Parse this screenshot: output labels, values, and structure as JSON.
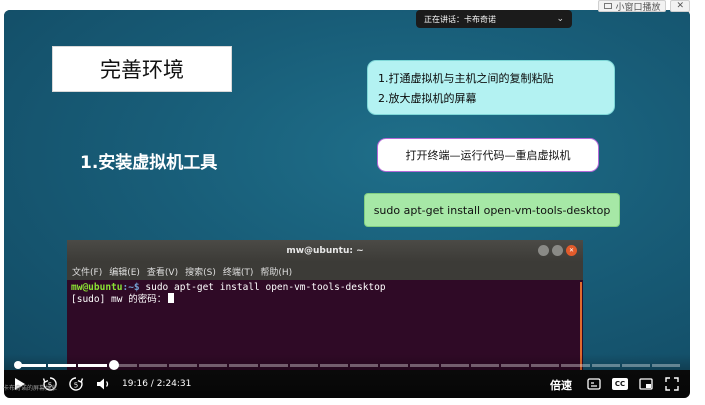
{
  "top_controls": {
    "mini_player_label": "小窗口播放",
    "close_glyph": "✕"
  },
  "speaking_indicator": {
    "text": "正在讲话：卡布奇诺",
    "chevron": "⌄"
  },
  "slide": {
    "title": "完善环境",
    "step_title": "1.安装虚拟机工具",
    "note1": {
      "line1": "1.打通虚拟机与主机之间的复制粘贴",
      "line2": "2.放大虚拟机的屏幕"
    },
    "note2": "打开终端—运行代码—重启虚拟机",
    "note3": "sudo apt-get install open-vm-tools-desktop"
  },
  "terminal": {
    "title": "mw@ubuntu: ~",
    "menu": [
      "文件(F)",
      "编辑(E)",
      "查看(V)",
      "搜索(S)",
      "终端(T)",
      "帮助(H)"
    ],
    "prompt_user": "mw@ubuntu",
    "prompt_path": ":~$",
    "command": " sudo apt-get install open-vm-tools-desktop",
    "line2": "[sudo] mw 的密码："
  },
  "player": {
    "progress_fraction": 0.145,
    "time": "19:16 / 2:24:31",
    "rewind_label": "5",
    "forward_label": "5",
    "speed_label": "倍速",
    "cc_label": "CC",
    "watermark": "卡布奇诺的屏幕共享"
  }
}
